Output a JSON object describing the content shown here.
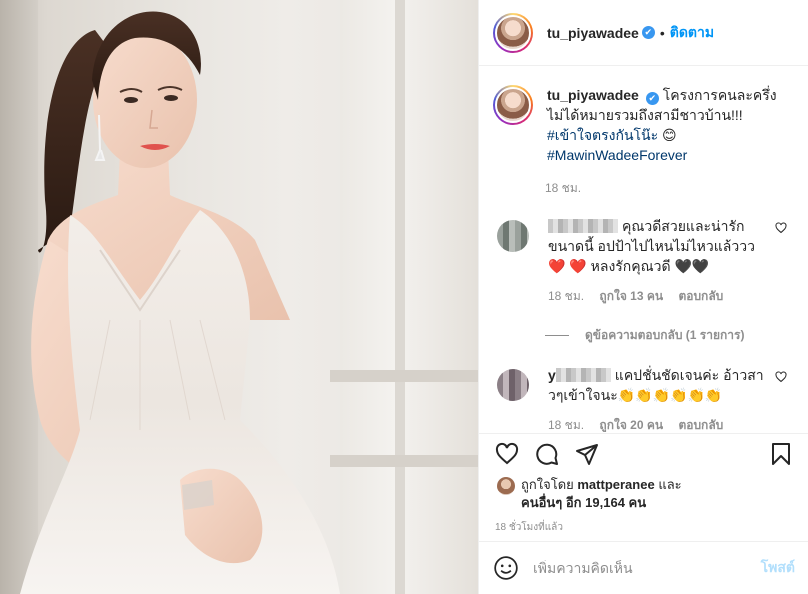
{
  "post": {
    "username": "tu_piyawadee",
    "verified_mark": "✔",
    "separator": "•",
    "follow_label": "ติดตาม"
  },
  "caption": {
    "username": "tu_piyawadee",
    "text": "โครงการคนละครึ่ง ไม่ได้หมายรวมถึงสามีชาวบ้าน!!!",
    "hashtag1": "#เข้าใจตรงกันโน๊ะ",
    "emoji": "😊",
    "hashtag2": "#MawinWadeeForever",
    "time": "18 ชม."
  },
  "comments": [
    {
      "text": "คุณวดีสวยและน่ารักขนาดนี้ อปป้าไปไหนไม่ไหวแล้ววว",
      "text2": "❤️ ❤️ หลงรักคุณวดี 🖤🖤",
      "time": "18 ชม.",
      "likes": "ถูกใจ 13 คน",
      "reply": "ตอบกลับ",
      "view_replies": "ดูข้อความตอบกลับ (1 รายการ)"
    },
    {
      "username_partial": "y",
      "text": "แคปชั่นชัดเจนค่ะ อ้าวสาวๆเข้าใจนะ",
      "emoji": "👏👏👏👏👏👏",
      "time": "18 ชม.",
      "likes": "ถูกใจ 20 คน",
      "reply": "ตอบกลับ"
    }
  ],
  "likes_line": {
    "prefix": "ถูกใจโดย",
    "user": "mattperanee",
    "and": "และ",
    "others": "คนอื่นๆ อีก 19,164 คน"
  },
  "posted_ago": "18 ชั่วโมงที่แล้ว",
  "add_comment": {
    "placeholder": "เพิ่มความคิดเห็น",
    "post_label": "โพสต์"
  },
  "icons": {
    "like": "heart-icon",
    "comment": "comment-icon",
    "share": "share-icon",
    "save": "bookmark-icon",
    "emoji": "emoji-icon"
  },
  "colors": {
    "link": "#0095f6",
    "verified": "#3897f0",
    "muted": "#8e8e8e",
    "hashtag": "#00376b",
    "post_disabled": "#b2dffc"
  }
}
